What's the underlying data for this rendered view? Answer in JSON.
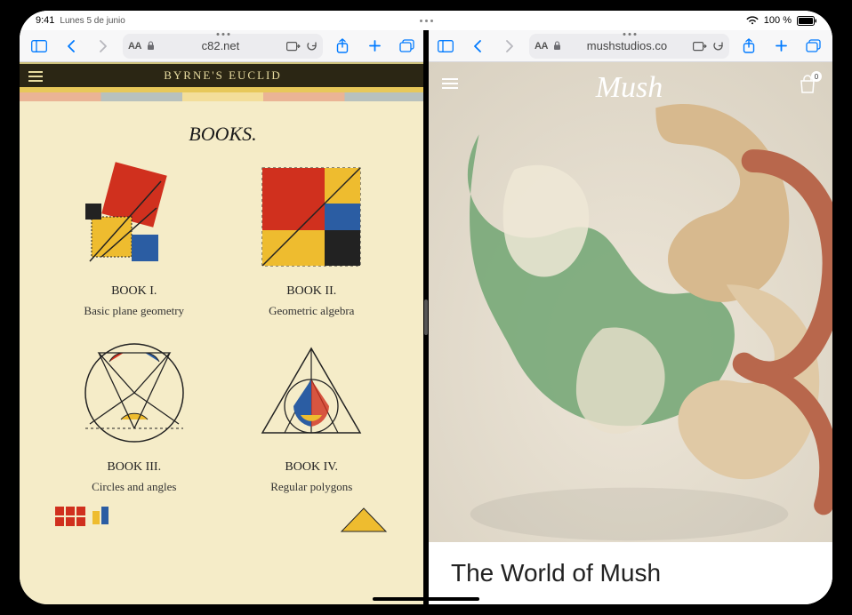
{
  "status": {
    "time": "9:41",
    "date": "Lunes 5 de junio",
    "battery": "100 %",
    "wifi": true
  },
  "left": {
    "toolbar": {
      "url": "c82.net",
      "aA": "AA"
    },
    "site": {
      "header": "BYRNE'S EUCLID",
      "section": "BOOKS.",
      "books": [
        {
          "label": "BOOK I.",
          "sub": "Basic plane geometry"
        },
        {
          "label": "BOOK II.",
          "sub": "Geometric algebra"
        },
        {
          "label": "BOOK III.",
          "sub": "Circles and angles"
        },
        {
          "label": "BOOK IV.",
          "sub": "Regular polygons"
        }
      ]
    }
  },
  "right": {
    "toolbar": {
      "url": "mushstudios.co",
      "aA": "AA"
    },
    "site": {
      "logo": "Mush",
      "bag_count": "0",
      "title": "The World of Mush"
    }
  },
  "colors": {
    "accent": "#007aff",
    "euclid_paper": "#f5ecc8",
    "euclid_red": "#d0301e",
    "euclid_blue": "#2b5da3",
    "euclid_yellow": "#eebc2f",
    "mush_green": "#79a97a",
    "mush_tan": "#d7b98e",
    "mush_terra": "#b8674c"
  }
}
